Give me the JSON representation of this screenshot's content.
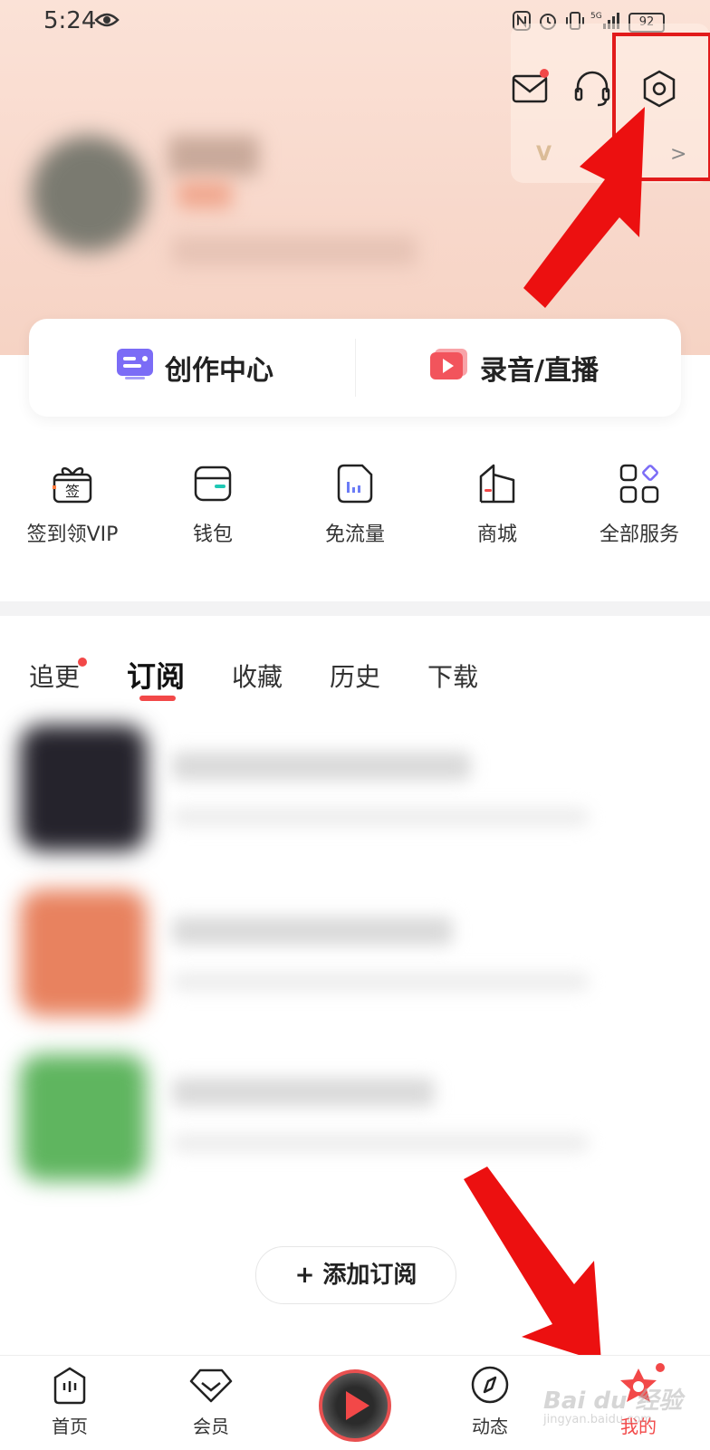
{
  "status_bar": {
    "time": "5:24",
    "battery": "92",
    "network": "5G"
  },
  "header": {
    "vip_text": "V",
    "vip_arrow": ">"
  },
  "creator_actions": [
    {
      "label": "创作中心",
      "icon": "creator-center-icon"
    },
    {
      "label": "录音/直播",
      "icon": "record-live-icon"
    }
  ],
  "services": [
    {
      "label": "签到领VIP",
      "icon": "gift-sign-icon",
      "icon_text": "签"
    },
    {
      "label": "钱包",
      "icon": "wallet-icon"
    },
    {
      "label": "免流量",
      "icon": "data-free-icon"
    },
    {
      "label": "商城",
      "icon": "store-icon"
    },
    {
      "label": "全部服务",
      "icon": "all-services-icon"
    }
  ],
  "tabs": [
    {
      "label": "追更",
      "badge": true
    },
    {
      "label": "订阅",
      "active": true
    },
    {
      "label": "收藏"
    },
    {
      "label": "历史"
    },
    {
      "label": "下载"
    }
  ],
  "add_subscription": "+ 添加订阅",
  "tabbar": [
    {
      "label": "首页",
      "icon": "home-icon"
    },
    {
      "label": "会员",
      "icon": "vip-diamond-icon"
    },
    {
      "label": "",
      "icon": "now-playing-disc-icon"
    },
    {
      "label": "动态",
      "icon": "compass-icon"
    },
    {
      "label": "我的",
      "icon": "profile-star-icon",
      "active": true
    }
  ],
  "watermark": {
    "main": "Bai du 经验",
    "sub": "jingyan.baidu.com"
  },
  "colors": {
    "accent": "#f24848",
    "annotation": "#e21b1b",
    "header_bg": "#f8d8cb"
  }
}
